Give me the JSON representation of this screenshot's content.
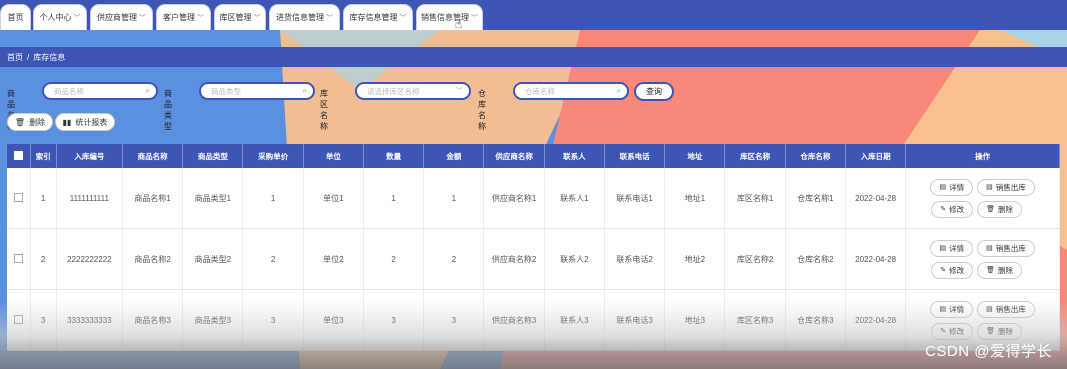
{
  "nav": {
    "items": [
      {
        "label": "首页",
        "chevron": false
      },
      {
        "label": "个人中心",
        "chevron": true
      },
      {
        "label": "供应商管理",
        "chevron": true
      },
      {
        "label": "客户管理",
        "chevron": true
      },
      {
        "label": "库区管理",
        "chevron": true
      },
      {
        "label": "进货信息管理",
        "chevron": true
      },
      {
        "label": "库存信息管理",
        "chevron": true
      },
      {
        "label": "销售信息管理",
        "chevron": true
      }
    ]
  },
  "breadcrumb": {
    "home": "首页",
    "separator": "/",
    "current": "库存信息"
  },
  "search": {
    "product_name_label": "商品名称",
    "product_name_placeholder": "商品名称",
    "product_type_label": "商品类型",
    "product_type_placeholder": "商品类型",
    "area_label": "库区名称",
    "area_placeholder": "请选择库区名称",
    "warehouse_label": "仓库名称",
    "warehouse_placeholder": "仓库名称",
    "query_button": "查询"
  },
  "actions": {
    "delete_label": "删除",
    "report_label": "统计报表"
  },
  "table": {
    "headers": [
      "索引",
      "入库编号",
      "商品名称",
      "商品类型",
      "采购单价",
      "单位",
      "数量",
      "金额",
      "供应商名称",
      "联系人",
      "联系电话",
      "地址",
      "库区名称",
      "仓库名称",
      "入库日期",
      "操作"
    ],
    "rows": [
      {
        "cells": [
          "1",
          "1111111111",
          "商品名称1",
          "商品类型1",
          "1",
          "单位1",
          "1",
          "1",
          "供应商名称1",
          "联系人1",
          "联系电话1",
          "地址1",
          "库区名称1",
          "仓库名称1",
          "2022-04-28"
        ]
      },
      {
        "cells": [
          "2",
          "2222222222",
          "商品名称2",
          "商品类型2",
          "2",
          "单位2",
          "2",
          "2",
          "供应商名称2",
          "联系人2",
          "联系电话2",
          "地址2",
          "库区名称2",
          "仓库名称2",
          "2022-04-28"
        ]
      },
      {
        "cells": [
          "3",
          "3333333333",
          "商品名称3",
          "商品类型3",
          "3",
          "单位3",
          "3",
          "3",
          "供应商名称3",
          "联系人3",
          "联系电话3",
          "地址3",
          "库区名称3",
          "仓库名称3",
          "2022-04-28"
        ]
      }
    ],
    "row_buttons": {
      "detail": "详情",
      "sell_out": "销售出库",
      "edit": "修改",
      "delete": "删除"
    }
  },
  "watermark": "CSDN @爱得学长",
  "colors": {
    "primary": "#3d55b5",
    "bg_blue": "#5b8fe0",
    "bg_peach": "#f9c08f",
    "bg_salmon": "#f9877a"
  }
}
